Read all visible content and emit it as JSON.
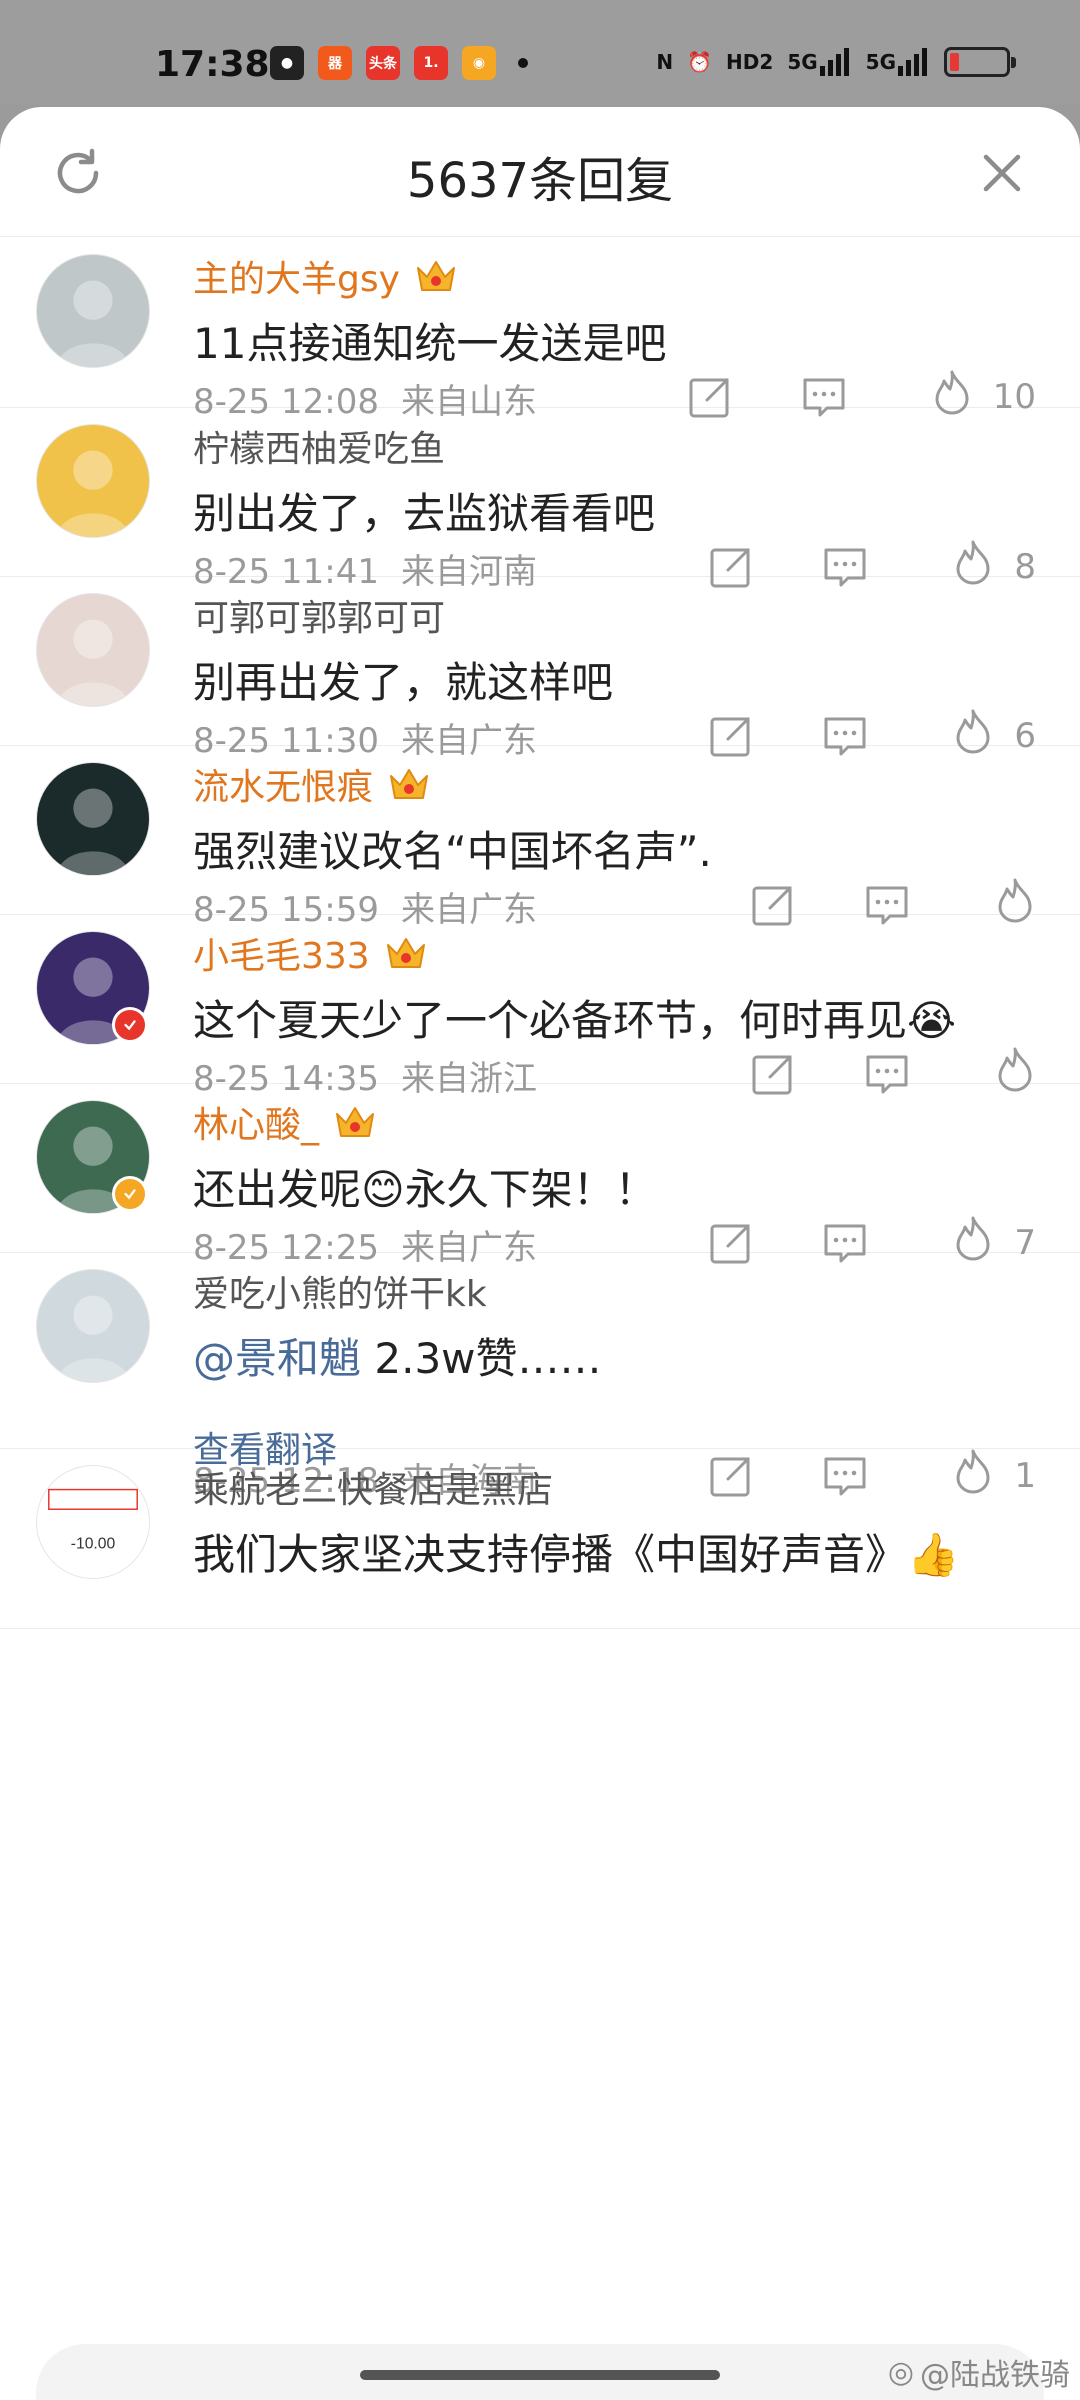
{
  "status_bar": {
    "time": "17:38",
    "app_icons": [
      {
        "name": "wechat-icon",
        "color": "#222222",
        "glyph": "●"
      },
      {
        "name": "app-orange-icon",
        "color": "#f25a1c",
        "glyph": "器"
      },
      {
        "name": "toutiao-icon",
        "color": "#e8352c",
        "glyph": "头条"
      },
      {
        "name": "app-1-icon",
        "color": "#e8352c",
        "glyph": "1."
      },
      {
        "name": "weibo-icon",
        "color": "#f5a623",
        "glyph": "◉"
      }
    ],
    "indicators": [
      "N",
      "⏰",
      "HD2",
      "5G",
      "5G"
    ]
  },
  "header": {
    "title": "5637条回复"
  },
  "comments": [
    {
      "name": "主的大羊gsy",
      "vip": true,
      "crown_level": "6",
      "text": "11点接通知统一发送是吧",
      "time": "8-25 12:08",
      "location": "来自山东",
      "likes": "10",
      "avatar_color": "#bfc7c9",
      "badge": null
    },
    {
      "name": "柠檬西柚爱吃鱼",
      "vip": false,
      "text": "别出发了，去监狱看看吧",
      "time": "8-25 11:41",
      "location": "来自河南",
      "likes": "8",
      "avatar_color": "#f1c24a",
      "badge": null
    },
    {
      "name": "可郭可郭郭可可",
      "vip": false,
      "text": "别再出发了，就这样吧",
      "time": "8-25 11:30",
      "location": "来自广东",
      "likes": "6",
      "avatar_color": "#e6d7d2",
      "badge": null
    },
    {
      "name": "流水无恨痕",
      "vip": true,
      "crown_level": "6",
      "text": "强烈建议改名“中国坏名声”.",
      "time": "8-25 15:59",
      "location": "来自广东",
      "likes": "",
      "avatar_color": "#1b2a2a",
      "badge": null
    },
    {
      "name": "小毛毛333",
      "vip": true,
      "crown_level": "5",
      "text": "这个夏天少了一个必备环节，何时再见😭",
      "time": "8-25 14:35",
      "location": "来自浙江",
      "likes": "",
      "avatar_color": "#3b2a6a",
      "badge": "#e8352c"
    },
    {
      "name": "林心酸_",
      "vip": true,
      "crown_level": "6",
      "text": "还出发呢😊永久下架！！",
      "time": "8-25 12:25",
      "location": "来自广东",
      "likes": "7",
      "avatar_color": "#3f6a52",
      "badge": "#f5a623"
    },
    {
      "name": "爱吃小熊的饼干kk",
      "vip": false,
      "mention": "@景和魈",
      "text": " 2.3w赞……",
      "translate": "查看翻译",
      "time": "8-25 12:18",
      "location": "来自海南",
      "likes": "1",
      "avatar_color": "#cfd9de",
      "badge": null
    },
    {
      "name": "乘航老二快餐店是黑店",
      "vip": false,
      "text": "我们大家坚决支持停播《中国好声音》👍",
      "avatar_color": "#ffffff",
      "avatar_text": "-10.00",
      "badge": null
    }
  ],
  "input": {
    "placeholder": ""
  },
  "watermark": "@陆战铁骑"
}
